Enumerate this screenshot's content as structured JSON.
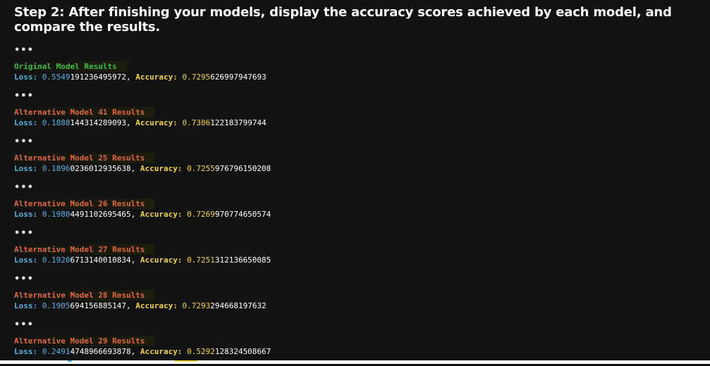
{
  "heading": "Step 2: After finishing your models, display the accuracy scores achieved by each model, and compare the results.",
  "ellipsis": "•••",
  "labels": {
    "loss": "Loss:",
    "accuracy": "Accuracy:",
    "separator": ","
  },
  "results": [
    {
      "title": "Original Model Results",
      "kind": "original",
      "loss_head": "0.5549",
      "loss_tail": "191236495972",
      "acc_head": "0.7295",
      "acc_tail": "626997947693"
    },
    {
      "title": "Alternative Model 41 Results",
      "kind": "alt",
      "loss_head": "0.1888",
      "loss_tail": "144314289093",
      "acc_head": "0.7306",
      "acc_tail": "122183799744"
    },
    {
      "title": "Alternative Model 25 Results",
      "kind": "alt",
      "loss_head": "0.1896",
      "loss_tail": "0236012935638",
      "acc_head": "0.7255",
      "acc_tail": "976796150208"
    },
    {
      "title": "Alternative Model 26 Results",
      "kind": "alt",
      "loss_head": "0.1980",
      "loss_tail": "4491102695465",
      "acc_head": "0.7269",
      "acc_tail": "970774650574"
    },
    {
      "title": "Alternative Model 27 Results",
      "kind": "alt",
      "loss_head": "0.1920",
      "loss_tail": "6713140010834",
      "acc_head": "0.7251",
      "acc_tail": "312136650085"
    },
    {
      "title": "Alternative Model 28 Results",
      "kind": "alt",
      "loss_head": "0.1905",
      "loss_tail": "694156885147",
      "acc_head": "0.7293",
      "acc_tail": "294668197632"
    },
    {
      "title": "Alternative Model 29 Results",
      "kind": "alt",
      "loss_head": "0.2491",
      "loss_tail": "4748966693878",
      "acc_head": "0.5292",
      "acc_tail": "128324508667"
    }
  ],
  "colors": {
    "background": "#121212",
    "original_title": "#3fbf3f",
    "alt_title": "#e0683a",
    "loss": "#4fb3e3",
    "accuracy": "#f2d43a"
  }
}
